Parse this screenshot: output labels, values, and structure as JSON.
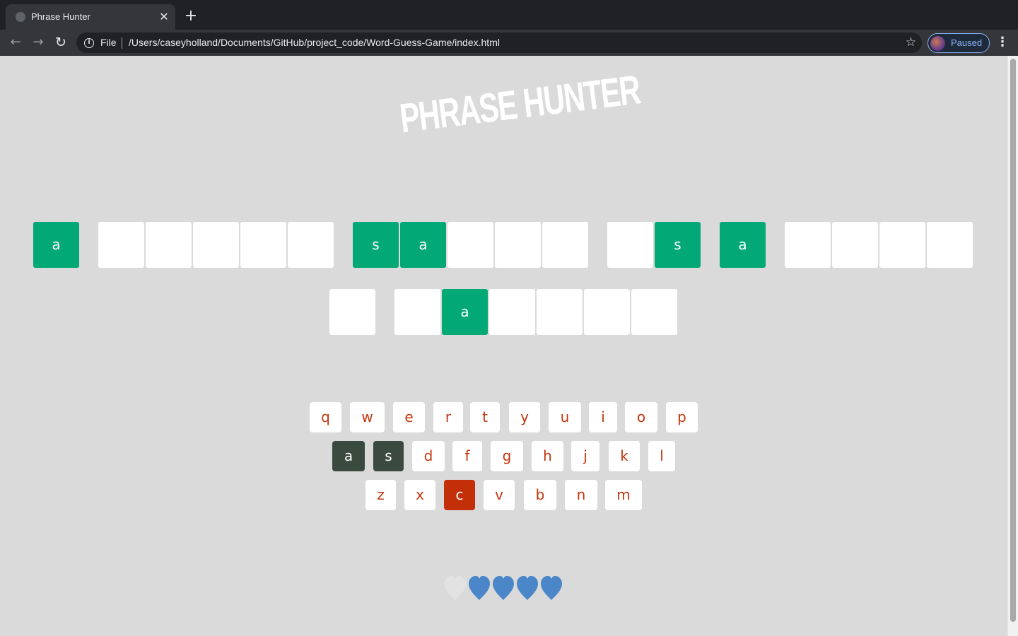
{
  "browser": {
    "tab_title": "Phrase Hunter",
    "tab_close_glyph": "✕",
    "new_tab_glyph": "+",
    "scheme_label": "File",
    "url": "/Users/caseyholland/Documents/GitHub/project_code/Word-Guess-Game/index.html",
    "profile_label": "Paused",
    "icons": [
      "back-arrow-icon",
      "forward-arrow-icon",
      "reload-icon",
      "info-icon",
      "star-icon",
      "menu-icon"
    ]
  },
  "game": {
    "title": "PHRASE HUNTER",
    "phrase_tiles": [
      {
        "letter": "a",
        "shown": true
      },
      {
        "letter": "",
        "shown": false
      },
      {
        "letter": "",
        "shown": false
      },
      {
        "letter": "",
        "shown": false
      },
      {
        "letter": "",
        "shown": false
      },
      {
        "letter": "",
        "shown": false
      },
      {
        "letter": "s",
        "shown": true
      },
      {
        "letter": "a",
        "shown": true
      },
      {
        "letter": "",
        "shown": false
      },
      {
        "letter": "",
        "shown": false
      },
      {
        "letter": "",
        "shown": false
      },
      {
        "letter": "",
        "shown": false
      },
      {
        "letter": "s",
        "shown": true
      },
      {
        "letter": "a",
        "shown": true
      },
      {
        "letter": "",
        "shown": false
      },
      {
        "letter": "",
        "shown": false
      },
      {
        "letter": "",
        "shown": false
      },
      {
        "letter": "",
        "shown": false
      },
      {
        "letter": "",
        "shown": false
      },
      {
        "letter": "",
        "shown": false
      },
      {
        "letter": "a",
        "shown": true
      },
      {
        "letter": "",
        "shown": false
      },
      {
        "letter": "",
        "shown": false
      },
      {
        "letter": "",
        "shown": false
      },
      {
        "letter": "",
        "shown": false
      }
    ],
    "keyboard_rows": [
      [
        {
          "key": "q",
          "state": "unused"
        },
        {
          "key": "w",
          "state": "unused"
        },
        {
          "key": "e",
          "state": "unused"
        },
        {
          "key": "r",
          "state": "unused"
        },
        {
          "key": "t",
          "state": "unused"
        },
        {
          "key": "y",
          "state": "unused"
        },
        {
          "key": "u",
          "state": "unused"
        },
        {
          "key": "i",
          "state": "unused"
        },
        {
          "key": "o",
          "state": "unused"
        },
        {
          "key": "p",
          "state": "unused"
        }
      ],
      [
        {
          "key": "a",
          "state": "chosen"
        },
        {
          "key": "s",
          "state": "chosen"
        },
        {
          "key": "d",
          "state": "unused"
        },
        {
          "key": "f",
          "state": "unused"
        },
        {
          "key": "g",
          "state": "unused"
        },
        {
          "key": "h",
          "state": "unused"
        },
        {
          "key": "j",
          "state": "unused"
        },
        {
          "key": "k",
          "state": "unused"
        },
        {
          "key": "l",
          "state": "unused"
        }
      ],
      [
        {
          "key": "z",
          "state": "unused"
        },
        {
          "key": "x",
          "state": "unused"
        },
        {
          "key": "c",
          "state": "wrong"
        },
        {
          "key": "v",
          "state": "unused"
        },
        {
          "key": "b",
          "state": "unused"
        },
        {
          "key": "n",
          "state": "unused"
        },
        {
          "key": "m",
          "state": "unused"
        }
      ]
    ],
    "lives": {
      "total": 5,
      "remaining": 4,
      "hearts": [
        "lost",
        "live",
        "live",
        "live",
        "live"
      ]
    }
  },
  "colors": {
    "chrome_dark": "#202124",
    "chrome_toolbar": "#35363a",
    "page_background": "#dadada",
    "tile_revealed": "#02a876",
    "tile_hidden": "#ffffff",
    "key_text": "#c3360c",
    "key_chosen": "#3b4a3f",
    "key_wrong": "#c32f08",
    "heart_live": "#4a86c8",
    "heart_lost": "#e2e2e2"
  }
}
